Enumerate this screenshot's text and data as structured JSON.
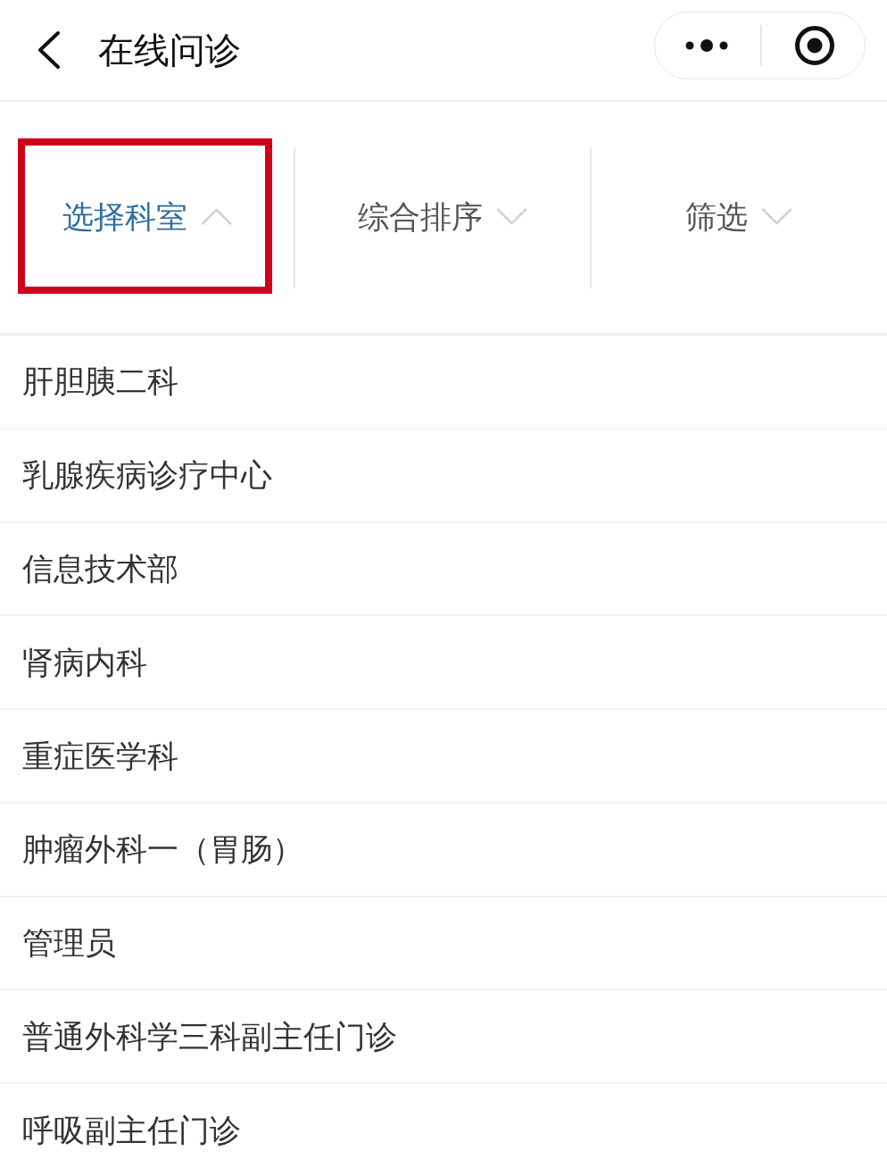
{
  "header": {
    "title": "在线问诊"
  },
  "filter_tabs": [
    {
      "label": "选择科室",
      "selected": true,
      "highlighted": true
    },
    {
      "label": "综合排序",
      "selected": false,
      "highlighted": false
    },
    {
      "label": "筛选",
      "selected": false,
      "highlighted": false
    }
  ],
  "departments": [
    {
      "name": "肝胆胰二科"
    },
    {
      "name": "乳腺疾病诊疗中心"
    },
    {
      "name": "信息技术部"
    },
    {
      "name": "肾病内科"
    },
    {
      "name": "重症医学科"
    },
    {
      "name": "肿瘤外科一（胃肠）"
    },
    {
      "name": "管理员"
    },
    {
      "name": "普通外科学三科副主任门诊"
    },
    {
      "name": "呼吸副主任门诊"
    }
  ]
}
